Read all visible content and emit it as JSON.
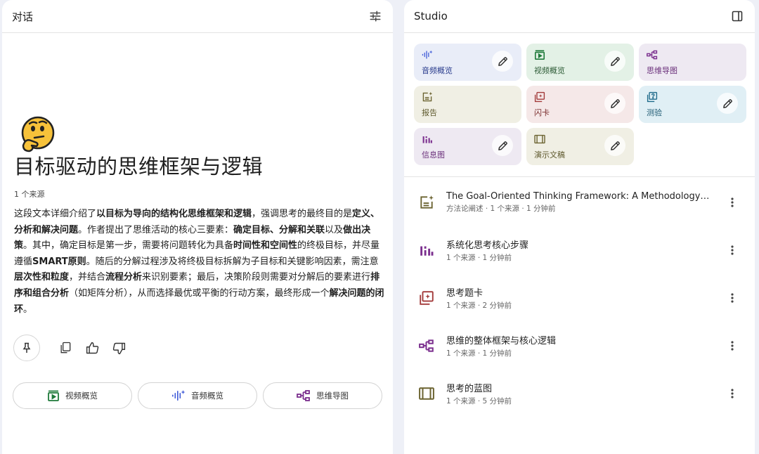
{
  "chat": {
    "title": "对话",
    "doc_title": "目标驱动的思维框架与逻辑",
    "source_count": "1 个来源",
    "summary": [
      {
        "t": "这段文本详细介绍了",
        "b": false
      },
      {
        "t": "以目标为导向的结构化思维框架和逻辑",
        "b": true
      },
      {
        "t": "，强调思考的最终目的是",
        "b": false
      },
      {
        "t": "定义、分析和解决问题",
        "b": true
      },
      {
        "t": "。作者提出了思维活动的核心三要素：",
        "b": false
      },
      {
        "t": "确定目标、分解和关联",
        "b": true
      },
      {
        "t": "以及",
        "b": false
      },
      {
        "t": "做出决策",
        "b": true
      },
      {
        "t": "。其中，确定目标是第一步，需要将问题转化为具备",
        "b": false
      },
      {
        "t": "时间性和空间性",
        "b": true
      },
      {
        "t": "的终极目标，并尽量遵循",
        "b": false
      },
      {
        "t": "SMART原则",
        "b": true
      },
      {
        "t": "。随后的分解过程涉及将终极目标拆解为子目标和关键影响因素，需注意",
        "b": false
      },
      {
        "t": "层次性和粒度",
        "b": true
      },
      {
        "t": "，并结合",
        "b": false
      },
      {
        "t": "流程分析",
        "b": true
      },
      {
        "t": "来识别要素；最后，决策阶段则需要对分解后的要素进行",
        "b": false
      },
      {
        "t": "排序和组合分析",
        "b": true
      },
      {
        "t": "（如矩阵分析），从而选择最优或平衡的行动方案，最终形成一个",
        "b": false
      },
      {
        "t": "解决问题的闭环",
        "b": true
      },
      {
        "t": "。",
        "b": false
      }
    ],
    "chips": [
      {
        "label": "视频概览",
        "icon": "video-overview-icon"
      },
      {
        "label": "音频概览",
        "icon": "audio-overview-icon"
      },
      {
        "label": "思维导图",
        "icon": "mind-map-icon"
      }
    ]
  },
  "studio": {
    "title": "Studio",
    "cards": [
      {
        "label": "音频概览",
        "icon": "audio-overview-icon",
        "color": "blue",
        "editable": true
      },
      {
        "label": "视频概览",
        "icon": "video-overview-icon",
        "color": "green",
        "editable": true
      },
      {
        "label": "思维导图",
        "icon": "mind-map-icon",
        "color": "purple",
        "editable": false
      },
      {
        "label": "报告",
        "icon": "report-icon",
        "color": "olive",
        "editable": false
      },
      {
        "label": "闪卡",
        "icon": "flashcard-icon",
        "color": "pink",
        "editable": true
      },
      {
        "label": "测验",
        "icon": "quiz-icon",
        "color": "cyan",
        "editable": true
      },
      {
        "label": "信息图",
        "icon": "infographic-icon",
        "color": "purple",
        "editable": true
      },
      {
        "label": "演示文稿",
        "icon": "slides-icon",
        "color": "olive",
        "editable": true
      }
    ],
    "artifacts": [
      {
        "title": "The Goal-Oriented Thinking Framework: A Methodology fo...",
        "meta": "方法论阐述 · 1 个来源 · 1 分钟前",
        "icon": "report-icon"
      },
      {
        "title": "系统化思考核心步骤",
        "meta": "1 个来源 · 1 分钟前",
        "icon": "infographic-icon"
      },
      {
        "title": "思考题卡",
        "meta": "1 个来源 · 2 分钟前",
        "icon": "flashcard-icon"
      },
      {
        "title": "思维的整体框架与核心逻辑",
        "meta": "1 个来源 · 1 分钟前",
        "icon": "mind-map-icon"
      },
      {
        "title": "思考的蓝图",
        "meta": "1 个来源 · 5 分钟前",
        "icon": "slides-icon"
      }
    ]
  }
}
